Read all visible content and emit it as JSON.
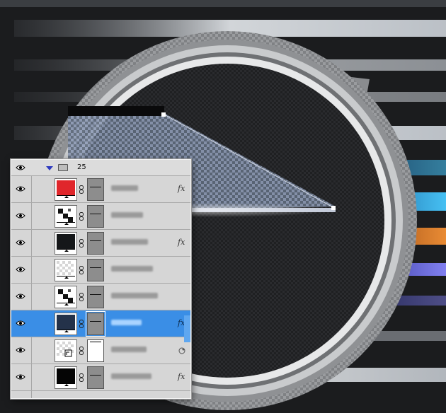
{
  "canvas": {
    "colors": {
      "background": "#1b1c1e",
      "ring_outer": "#8b8d90",
      "ring_inner": "#c4c6c8",
      "dial_face": "#232426",
      "stripe_light": "#e9eef4",
      "stripe_blue": "#3fb6ef",
      "stripe_orange": "#e07d2b",
      "stripe_violet": "#6d6ee8"
    }
  },
  "layers_panel": {
    "group": {
      "name": "25",
      "expanded": true,
      "icons": [
        "eye-icon",
        "disclosure-triangle-icon",
        "folder-icon"
      ]
    },
    "layers": [
      {
        "thumb": "red-fill",
        "thumb_color": "#e0262b",
        "effects": "fx",
        "selected": false
      },
      {
        "thumb": "checker-pattern",
        "thumb_color": "#ffffff",
        "effects": "",
        "selected": false
      },
      {
        "thumb": "dark-fill",
        "thumb_color": "#151719",
        "effects": "fx",
        "selected": false
      },
      {
        "thumb": "transparent-fill",
        "thumb_color": "#f4f4f4",
        "effects": "",
        "selected": false
      },
      {
        "thumb": "checker-pattern",
        "thumb_color": "#ffffff",
        "effects": "",
        "selected": false
      },
      {
        "thumb": "navy-fill",
        "thumb_color": "#24324a",
        "effects": "fx",
        "selected": true
      },
      {
        "thumb": "smart-object",
        "thumb_color": "#ededed",
        "effects": "",
        "selected": false,
        "extra_icon": "smart-filter-icon"
      },
      {
        "thumb": "black-fill",
        "thumb_color": "#050505",
        "effects": "fx",
        "selected": false
      }
    ],
    "selection_color": "#3a8ee6"
  }
}
